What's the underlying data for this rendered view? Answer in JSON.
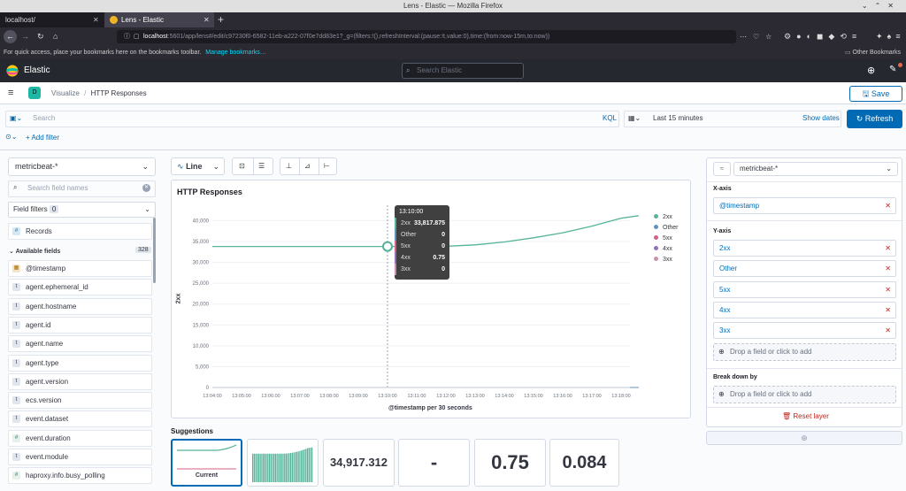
{
  "browser": {
    "window_title": "Lens - Elastic — Mozilla Firefox",
    "tabs": [
      {
        "label": "localhost/"
      },
      {
        "label": "Lens - Elastic"
      }
    ],
    "url_host": "localhost",
    "url_rest": ":5601/app/lens#/edit/c97230f0-6582-11eb-a222-07f0e7dd83e1?_g=(filters:!(),refreshInterval:(pause:!t,value:0),time:(from:now-15m,to:now))",
    "bookmarks_hint": "For quick access, place your bookmarks here on the bookmarks toolbar.",
    "bookmarks_link": "Manage bookmarks…",
    "other_bookmarks": "Other Bookmarks"
  },
  "kibana": {
    "brand": "Elastic",
    "search_placeholder": "Search Elastic",
    "space_initial": "D",
    "breadcrumbs": [
      "Visualize",
      "HTTP Responses"
    ],
    "save_label": "Save"
  },
  "query": {
    "placeholder": "Search",
    "language": "KQL",
    "time_range": "Last 15 minutes",
    "show_dates": "Show dates",
    "refresh": "Refresh",
    "add_filter": "+ Add filter"
  },
  "fieldlist": {
    "index_pattern": "metricbeat-*",
    "search_placeholder": "Search field names",
    "filters_label": "Field filters",
    "filters_count": "0",
    "records": "Records",
    "available_label": "Available fields",
    "available_count": "328",
    "fields": [
      {
        "type": "date",
        "name": "@timestamp"
      },
      {
        "type": "t",
        "name": "agent.ephemeral_id"
      },
      {
        "type": "t",
        "name": "agent.hostname"
      },
      {
        "type": "t",
        "name": "agent.id"
      },
      {
        "type": "t",
        "name": "agent.name"
      },
      {
        "type": "t",
        "name": "agent.type"
      },
      {
        "type": "t",
        "name": "agent.version"
      },
      {
        "type": "t",
        "name": "ecs.version"
      },
      {
        "type": "t",
        "name": "event.dataset"
      },
      {
        "type": "#",
        "name": "event.duration"
      },
      {
        "type": "t",
        "name": "event.module"
      },
      {
        "type": "#",
        "name": "haproxy.info.busy_polling"
      }
    ]
  },
  "toolbar": {
    "chart_type": "Line"
  },
  "chart_data": {
    "type": "line",
    "title": "HTTP Responses",
    "xlabel": "@timestamp per 30 seconds",
    "ylabel": "2xx",
    "x": [
      "13:04:00",
      "13:05:00",
      "13:06:00",
      "13:07:00",
      "13:08:00",
      "13:09:00",
      "13:10:00",
      "13:11:00",
      "13:12:00",
      "13:13:00",
      "13:14:00",
      "13:15:00",
      "13:16:00",
      "13:17:00",
      "13:18:00"
    ],
    "ylim": [
      0,
      42000
    ],
    "yticks": [
      "40,000",
      "35,000",
      "30,000",
      "25,000",
      "20,000",
      "15,000",
      "10,000",
      "5,000",
      "0"
    ],
    "legend_position": "top-right",
    "series": [
      {
        "name": "2xx",
        "color": "#54b399",
        "values": [
          33817.875,
          33817.875,
          33817.875,
          33817.875,
          33817.875,
          33817.875,
          33817.875,
          33817.875,
          33850,
          34200,
          34900,
          35900,
          37100,
          38700,
          40600,
          41200
        ]
      },
      {
        "name": "Other",
        "color": "#6092c0",
        "values": [
          0,
          0,
          0,
          0,
          0,
          0,
          0,
          0,
          0,
          0,
          0,
          0,
          0,
          0,
          0,
          0
        ]
      },
      {
        "name": "5xx",
        "color": "#d36086",
        "values": [
          0,
          0,
          0,
          0,
          0,
          0,
          0,
          0,
          0,
          0,
          0,
          0,
          0,
          0,
          0,
          0
        ]
      },
      {
        "name": "4xx",
        "color": "#9170b8",
        "values": [
          0.75,
          0.75,
          0.75,
          0.75,
          0.75,
          0.75,
          0.75,
          0.75,
          0.75,
          0.75,
          0.75,
          0.75,
          0.75,
          0.75,
          0.75,
          0.75
        ]
      },
      {
        "name": "3xx",
        "color": "#ca8eae",
        "values": [
          0,
          0,
          0,
          0,
          0,
          0,
          0,
          0,
          0,
          0,
          0,
          0,
          0,
          0,
          0,
          0
        ]
      }
    ],
    "x_points": [
      "13:04:00",
      "13:05:00",
      "13:06:00",
      "13:07:00",
      "13:08:00",
      "13:09:00",
      "13:10:00",
      "13:11:00",
      "13:12:00",
      "13:13:00",
      "13:14:00",
      "13:15:00",
      "13:16:00",
      "13:17:00",
      "13:18:00",
      "13:18:30"
    ],
    "tooltip": {
      "time": "13:10:00",
      "rows": [
        {
          "label": "2xx",
          "value": "33,817.875",
          "color": "#54b399"
        },
        {
          "label": "Other",
          "value": "0",
          "color": "#6092c0"
        },
        {
          "label": "5xx",
          "value": "0",
          "color": "#d36086"
        },
        {
          "label": "4xx",
          "value": "0.75",
          "color": "#9170b8"
        },
        {
          "label": "3xx",
          "value": "0",
          "color": "#ca8eae"
        }
      ]
    }
  },
  "suggestions": {
    "title": "Suggestions",
    "current_label": "Current",
    "values": [
      "34,917.312",
      "-",
      "0.75",
      "0.084"
    ]
  },
  "layer": {
    "index_pattern": "metricbeat-*",
    "xaxis_label": "X-axis",
    "xaxis_field": "@timestamp",
    "yaxis_label": "Y-axis",
    "yaxis_fields": [
      "2xx",
      "Other",
      "5xx",
      "4xx",
      "3xx"
    ],
    "drop_text": "Drop a field or click to add",
    "breakdown_label": "Break down by",
    "reset": "Reset layer"
  }
}
